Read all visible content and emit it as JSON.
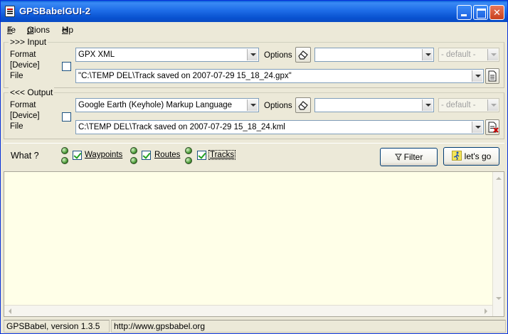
{
  "window": {
    "title": "GPSBabelGUI-2"
  },
  "menu": [
    {
      "label": "File",
      "accel": "F",
      "rest": "ile"
    },
    {
      "label": "Options",
      "accel": "O",
      "rest": "ptions"
    },
    {
      "label": "Help",
      "accel": "H",
      "rest": "elp"
    }
  ],
  "input": {
    "legend": ">>> Input",
    "format_label": "Format",
    "device_label": "[Device]",
    "file_label": "File",
    "format_value": "GPX XML",
    "options_label": "Options",
    "options_value": "",
    "default_value": "- default -",
    "file_value": "\"C:\\TEMP DEL\\Track saved on 2007-07-29 15_18_24.gpx\""
  },
  "output": {
    "legend": "<<< Output",
    "format_label": "Format",
    "device_label": "[Device]",
    "file_label": "File",
    "format_value": "Google Earth (Keyhole) Markup Language",
    "options_label": "Options",
    "options_value": "",
    "default_value": "- default -",
    "file_value": "C:\\TEMP DEL\\Track saved on 2007-07-29 15_18_24.kml"
  },
  "what": {
    "label": "What ?",
    "waypoints": {
      "label": "Waypoints",
      "checked": true
    },
    "routes": {
      "label": "Routes",
      "checked": true
    },
    "tracks": {
      "label": "Tracks",
      "checked": true
    },
    "filter_label": "Filter",
    "go_label": "let's go"
  },
  "output_area": {
    "text": ""
  },
  "status": {
    "version": "GPSBabel, version 1.3.5",
    "url": "http://www.gpsbabel.org"
  },
  "colors": {
    "title_bar": "#0a5fd8",
    "output_background": "#ffffe8",
    "window_background": "#ece9d8"
  }
}
